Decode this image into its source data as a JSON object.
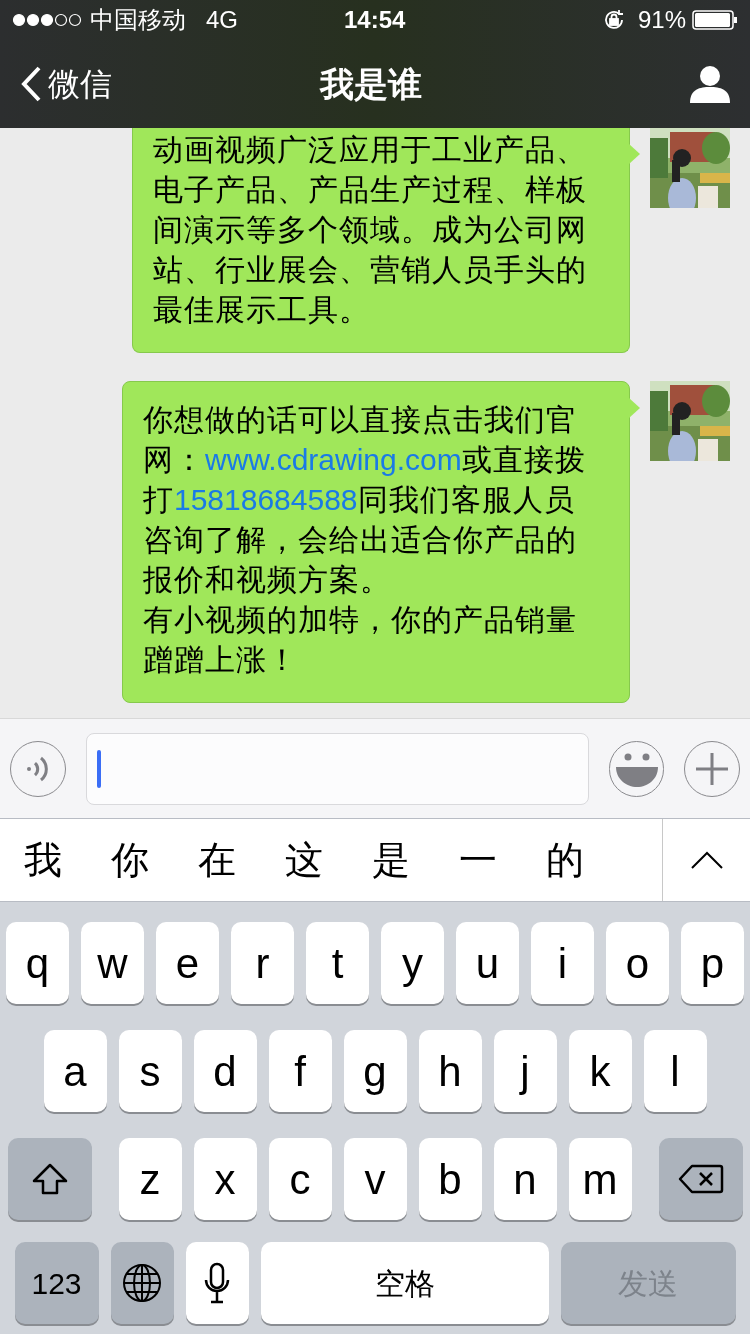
{
  "status_bar": {
    "carrier": "中国移动",
    "network": "4G",
    "time": "14:54",
    "battery": "91%"
  },
  "nav": {
    "back": "微信",
    "title": "我是谁"
  },
  "messages": [
    {
      "paragraphs": [
        [
          {
            "kind": "text",
            "text": "动画视频广泛应用于工业产品、电子产品、产品生产过程、样板间演示等多个领域。成为公司网站、行业展会、营销人员手头的最佳展示工具。"
          }
        ]
      ]
    },
    {
      "paragraphs": [
        [
          {
            "kind": "text",
            "text": "你想做的话可以直接点击我们官网："
          },
          {
            "kind": "link",
            "text": "www.cdrawing.com"
          },
          {
            "kind": "text",
            "text": "或直接拨打"
          },
          {
            "kind": "link",
            "text": "15818684588"
          },
          {
            "kind": "text",
            "text": "同我们客服人员咨询了解，会给出适合你产品的报价和视频方案。"
          }
        ],
        [
          {
            "kind": "text",
            "text": "有小视频的加特，你的产品销量蹭蹭上涨！"
          }
        ]
      ]
    }
  ],
  "candidates": [
    "我",
    "你",
    "在",
    "这",
    "是",
    "一",
    "的"
  ],
  "keyboard": {
    "rows": [
      {
        "keys": [
          {
            "kind": "char",
            "label": "q"
          },
          {
            "kind": "char",
            "label": "w"
          },
          {
            "kind": "char",
            "label": "e"
          },
          {
            "kind": "char",
            "label": "r"
          },
          {
            "kind": "char",
            "label": "t"
          },
          {
            "kind": "char",
            "label": "y"
          },
          {
            "kind": "char",
            "label": "u"
          },
          {
            "kind": "char",
            "label": "i"
          },
          {
            "kind": "char",
            "label": "o"
          },
          {
            "kind": "char",
            "label": "p"
          }
        ]
      },
      {
        "keys": [
          {
            "kind": "char",
            "label": "a"
          },
          {
            "kind": "char",
            "label": "s"
          },
          {
            "kind": "char",
            "label": "d"
          },
          {
            "kind": "char",
            "label": "f"
          },
          {
            "kind": "char",
            "label": "g"
          },
          {
            "kind": "char",
            "label": "h"
          },
          {
            "kind": "char",
            "label": "j"
          },
          {
            "kind": "char",
            "label": "k"
          },
          {
            "kind": "char",
            "label": "l"
          }
        ]
      },
      {
        "keys": [
          {
            "kind": "shift"
          },
          {
            "kind": "char",
            "label": "z"
          },
          {
            "kind": "char",
            "label": "x"
          },
          {
            "kind": "char",
            "label": "c"
          },
          {
            "kind": "char",
            "label": "v"
          },
          {
            "kind": "char",
            "label": "b"
          },
          {
            "kind": "char",
            "label": "n"
          },
          {
            "kind": "char",
            "label": "m"
          },
          {
            "kind": "delete"
          }
        ]
      },
      {
        "keys": [
          {
            "kind": "mode",
            "label": "123"
          },
          {
            "kind": "globe"
          },
          {
            "kind": "mic"
          },
          {
            "kind": "space",
            "label": "空格"
          },
          {
            "kind": "send",
            "label": "发送",
            "disabled": true
          }
        ]
      }
    ]
  }
}
